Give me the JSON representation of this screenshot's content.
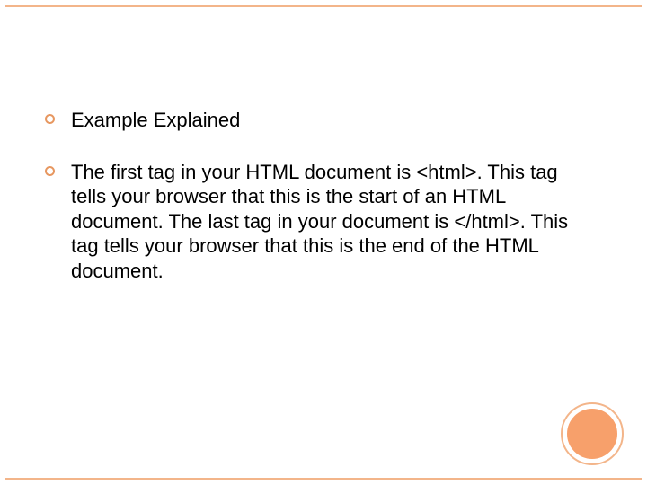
{
  "bullets": [
    {
      "text": "Example Explained"
    },
    {
      "text": "The first tag in your HTML document is <html>. This tag tells your browser that this is the start of an HTML document. The last tag in your document is </html>. This tag tells your browser that this is the end of the HTML document."
    }
  ],
  "colors": {
    "accent": "#f3b58a",
    "circle_fill": "#f7a06b"
  }
}
